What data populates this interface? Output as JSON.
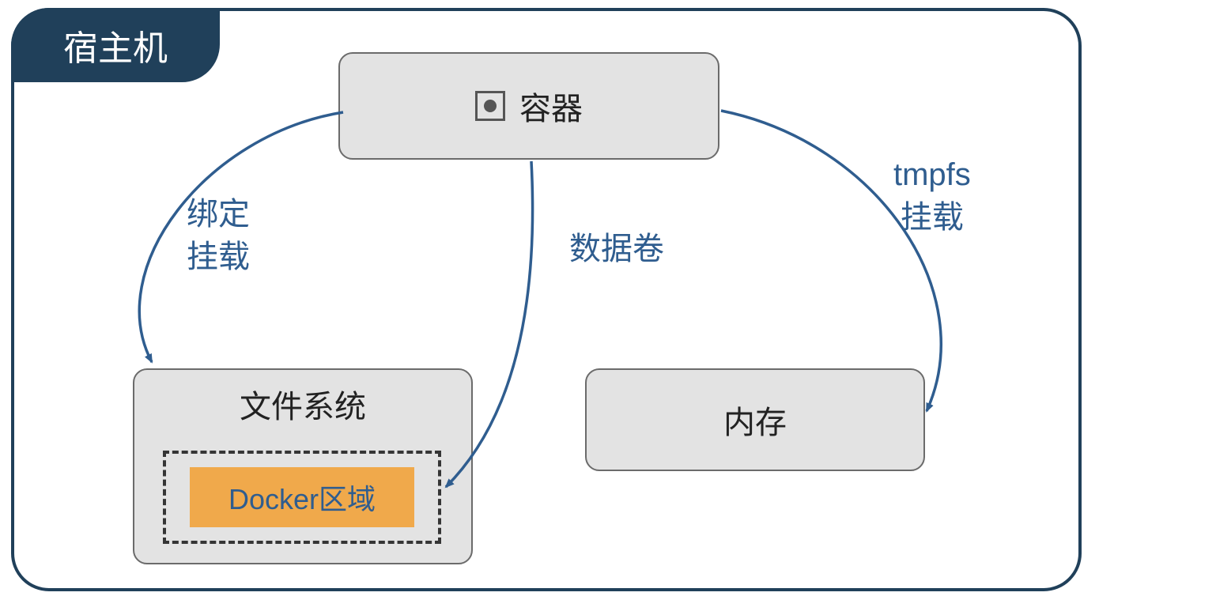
{
  "host": {
    "label": "宿主机"
  },
  "nodes": {
    "container": {
      "label": "容器"
    },
    "filesystem": {
      "label": "文件系统"
    },
    "docker_area": {
      "label": "Docker区域"
    },
    "memory": {
      "label": "内存"
    }
  },
  "edges": {
    "bind_mount": {
      "line1": "绑定",
      "line2": "挂载"
    },
    "volume": {
      "label": "数据卷"
    },
    "tmpfs": {
      "line1": "tmpfs",
      "line2": "挂载"
    }
  },
  "icons": {
    "container_icon": "radio-icon"
  },
  "colors": {
    "frame": "#20405a",
    "node_fill": "#e3e3e3",
    "node_border": "#6b6b6b",
    "docker_fill": "#f0a94b",
    "link": "#2f5d8f"
  }
}
